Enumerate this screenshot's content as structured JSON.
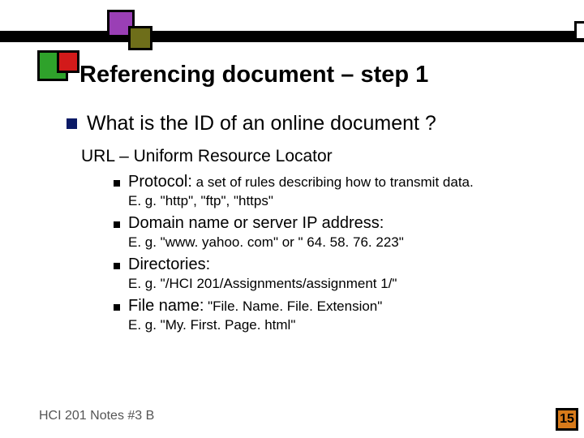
{
  "title": "Referencing document – step 1",
  "main": {
    "question": "What is the ID of an online document ?",
    "subhead": "URL – Uniform Resource Locator",
    "items": [
      {
        "label": "Protocol:",
        "def": " a set of rules describing how to transmit data.",
        "eg": "E. g. \"http\", \"ftp\", \"https\""
      },
      {
        "label": "Domain name or server IP address:",
        "def": "",
        "eg": "E. g. \"www. yahoo. com\" or \" 64. 58. 76. 223\""
      },
      {
        "label": "Directories:",
        "def": "",
        "eg": "E. g. \"/HCI 201/Assignments/assignment 1/\""
      },
      {
        "label": "File name:",
        "def": " \"File. Name. File. Extension\"",
        "eg": "E. g. \"My. First. Page. html\""
      }
    ]
  },
  "footer": {
    "left": "HCI 201 Notes #3 B",
    "page": "15"
  }
}
